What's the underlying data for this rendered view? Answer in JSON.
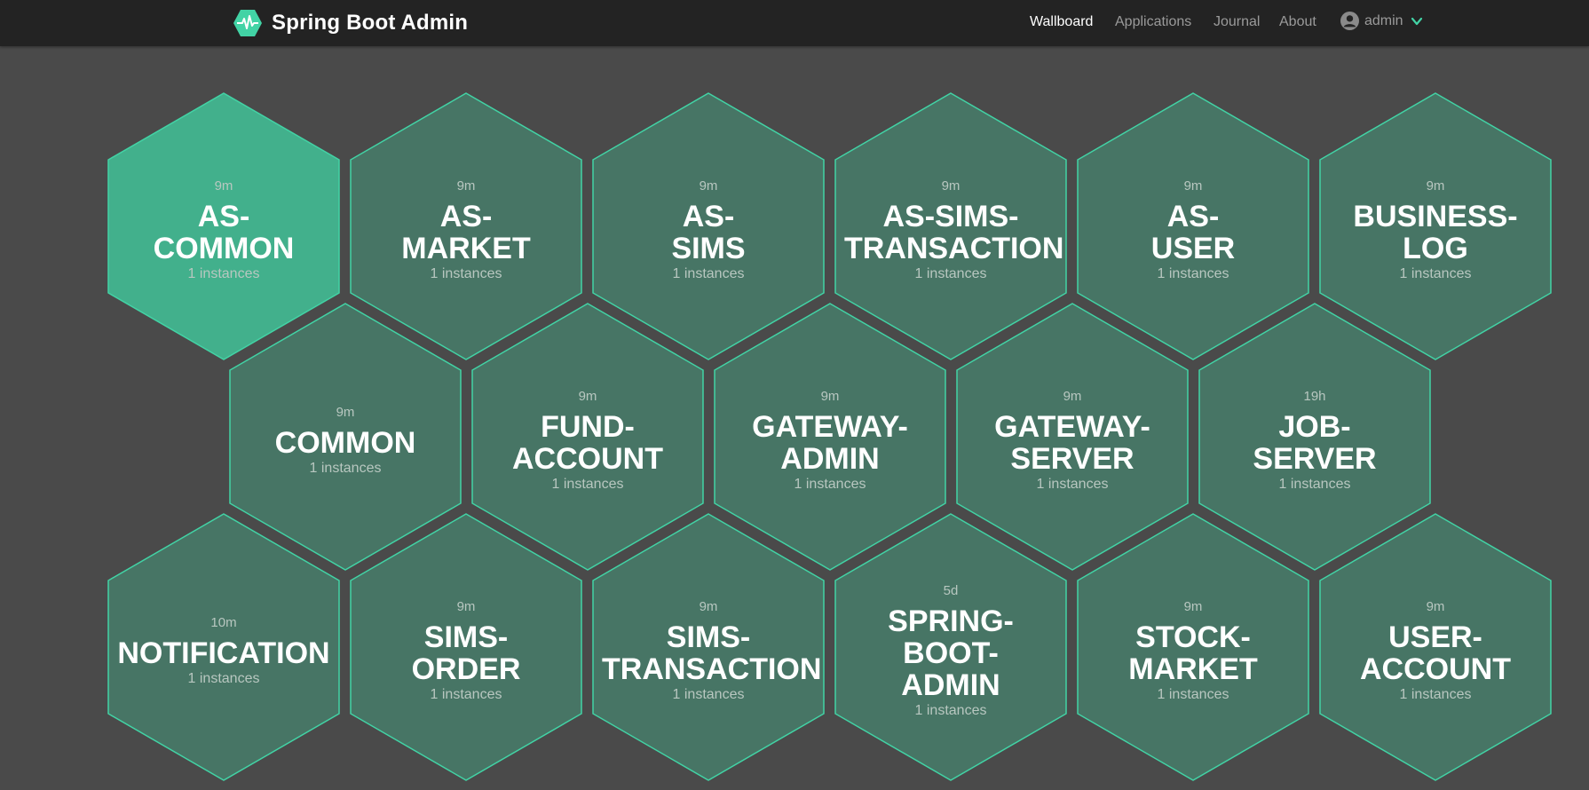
{
  "header": {
    "brand": "Spring Boot Admin",
    "nav": {
      "wallboard": "Wallboard",
      "applications": "Applications",
      "journal": "Journal",
      "about": "About"
    },
    "user": "admin"
  },
  "colors": {
    "background": "#4a4a4a",
    "navbar": "#232323",
    "hex_fill": "#477565",
    "hex_fill_selected": "#42b08c",
    "hex_border": "#42d3a5"
  },
  "applications": [
    {
      "name_lines": [
        "AS-",
        "COMMON"
      ],
      "age": "9m",
      "instances": "1 instances",
      "selected": true
    },
    {
      "name_lines": [
        "AS-",
        "MARKET"
      ],
      "age": "9m",
      "instances": "1 instances"
    },
    {
      "name_lines": [
        "AS-",
        "SIMS"
      ],
      "age": "9m",
      "instances": "1 instances"
    },
    {
      "name_lines": [
        "AS-SIMS-",
        "TRANSACTION"
      ],
      "age": "9m",
      "instances": "1 instances"
    },
    {
      "name_lines": [
        "AS-",
        "USER"
      ],
      "age": "9m",
      "instances": "1 instances"
    },
    {
      "name_lines": [
        "BUSINESS-",
        "LOG"
      ],
      "age": "9m",
      "instances": "1 instances"
    },
    {
      "name_lines": [
        "COMMON"
      ],
      "age": "9m",
      "instances": "1 instances"
    },
    {
      "name_lines": [
        "FUND-",
        "ACCOUNT"
      ],
      "age": "9m",
      "instances": "1 instances"
    },
    {
      "name_lines": [
        "GATEWAY-",
        "ADMIN"
      ],
      "age": "9m",
      "instances": "1 instances"
    },
    {
      "name_lines": [
        "GATEWAY-",
        "SERVER"
      ],
      "age": "9m",
      "instances": "1 instances"
    },
    {
      "name_lines": [
        "JOB-",
        "SERVER"
      ],
      "age": "19h",
      "instances": "1 instances"
    },
    {
      "name_lines": [
        "NOTIFICATION"
      ],
      "age": "10m",
      "instances": "1 instances"
    },
    {
      "name_lines": [
        "SIMS-",
        "ORDER"
      ],
      "age": "9m",
      "instances": "1 instances"
    },
    {
      "name_lines": [
        "SIMS-",
        "TRANSACTION"
      ],
      "age": "9m",
      "instances": "1 instances"
    },
    {
      "name_lines": [
        "SPRING-BOOT-",
        "ADMIN"
      ],
      "age": "5d",
      "instances": "1 instances"
    },
    {
      "name_lines": [
        "STOCK-",
        "MARKET"
      ],
      "age": "9m",
      "instances": "1 instances"
    },
    {
      "name_lines": [
        "USER-",
        "ACCOUNT"
      ],
      "age": "9m",
      "instances": "1 instances"
    }
  ]
}
